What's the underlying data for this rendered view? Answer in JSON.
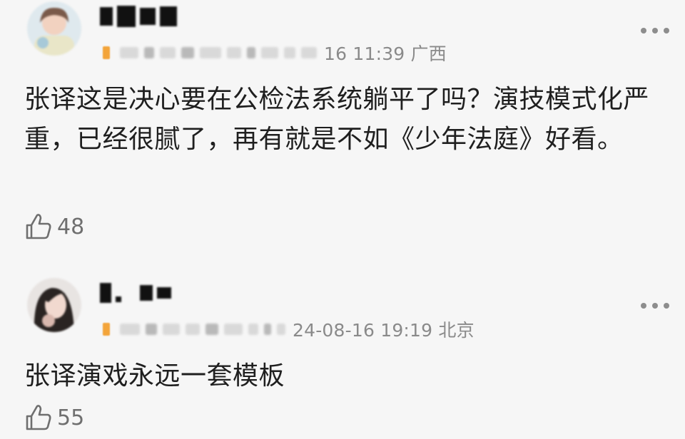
{
  "comments": [
    {
      "time_location": "16 11:39 广西",
      "text": "张译这是决心要在公检法系统躺平了吗？演技模式化严重，已经很腻了，再有就是不如《少年法庭》好看。",
      "likes": "48",
      "icons": {
        "like": "thumbs-up-icon",
        "more": "more-dots-icon",
        "badge": "fan-badge-icon"
      }
    },
    {
      "time_location": "24-08-16 19:19 北京",
      "text": "张译演戏永远一套模板",
      "likes": "55",
      "icons": {
        "like": "thumbs-up-icon",
        "more": "more-dots-icon",
        "badge": "fan-badge-icon"
      }
    }
  ],
  "colors": {
    "background": "#f6f6f6",
    "text": "#1f1f1f",
    "meta": "#8a8a8a",
    "badge": "#f3a43a"
  }
}
